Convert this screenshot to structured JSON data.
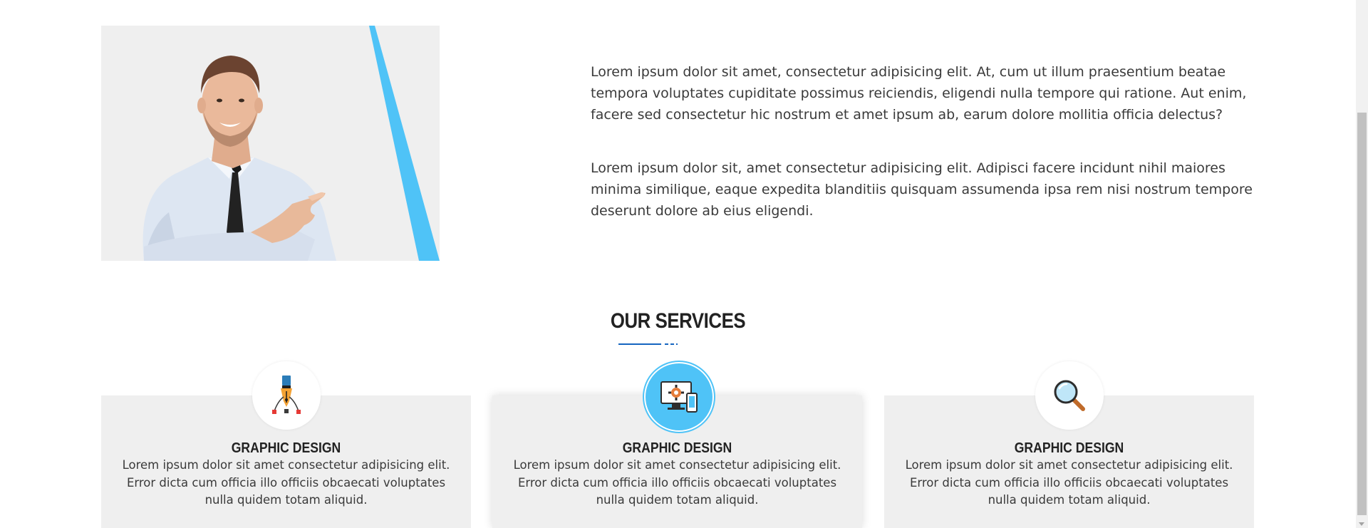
{
  "about": {
    "paragraphs": [
      "Lorem ipsum dolor sit amet, consectetur adipisicing elit. At, cum ut illum praesentium beatae tempora voluptates cupiditate possimus reiciendis, eligendi nulla tempore qui ratione. Aut enim, facere sed consectetur hic nostrum et amet ipsum ab, earum dolore mollitia officia delectus?",
      "Lorem ipsum dolor sit, amet consectetur adipisicing elit. Adipisci facere incidunt nihil maiores minima similique, eaque expedita blanditiis quisquam assumenda ipsa rem nisi nostrum tempore deserunt dolore ab eius eligendi."
    ],
    "image_icon": "man-pointing-photo"
  },
  "services": {
    "title": "OUR SERVICES",
    "accent_color": "#1565c0",
    "highlight_color": "#4fc3f7",
    "cards": [
      {
        "icon": "pen-tool-icon",
        "title": "GRAPHIC DESIGN",
        "description": "Lorem ipsum dolor sit amet consectetur adipisicing elit. Error dicta cum officia illo officiis obcaecati voluptates nulla quidem totam aliquid."
      },
      {
        "icon": "monitor-gear-icon",
        "title": "GRAPHIC DESIGN",
        "description": "Lorem ipsum dolor sit amet consectetur adipisicing elit. Error dicta cum officia illo officiis obcaecati voluptates nulla quidem totam aliquid."
      },
      {
        "icon": "magnifier-icon",
        "title": "GRAPHIC DESIGN",
        "description": "Lorem ipsum dolor sit amet consectetur adipisicing elit. Error dicta cum officia illo officiis obcaecati voluptates nulla quidem totam aliquid."
      }
    ]
  }
}
